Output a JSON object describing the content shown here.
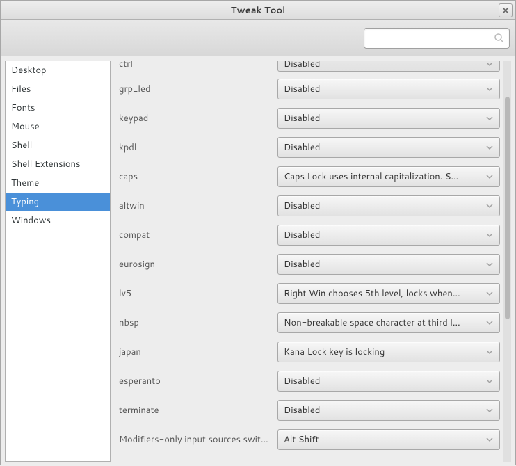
{
  "window": {
    "title": "Tweak Tool"
  },
  "search": {
    "value": "",
    "placeholder": ""
  },
  "sidebar": {
    "items": [
      {
        "label": "Desktop",
        "selected": false
      },
      {
        "label": "Files",
        "selected": false
      },
      {
        "label": "Fonts",
        "selected": false
      },
      {
        "label": "Mouse",
        "selected": false
      },
      {
        "label": "Shell",
        "selected": false
      },
      {
        "label": "Shell Extensions",
        "selected": false
      },
      {
        "label": "Theme",
        "selected": false
      },
      {
        "label": "Typing",
        "selected": true
      },
      {
        "label": "Windows",
        "selected": false
      }
    ]
  },
  "settings": {
    "rows": [
      {
        "label": "ctrl",
        "value": "Disabled"
      },
      {
        "label": "grp_led",
        "value": "Disabled"
      },
      {
        "label": "keypad",
        "value": "Disabled"
      },
      {
        "label": "kpdl",
        "value": "Disabled"
      },
      {
        "label": "caps",
        "value": "Caps Lock uses internal capitalization. S…"
      },
      {
        "label": "altwin",
        "value": "Disabled"
      },
      {
        "label": "compat",
        "value": "Disabled"
      },
      {
        "label": "eurosign",
        "value": "Disabled"
      },
      {
        "label": "lv5",
        "value": "Right Win chooses 5th level, locks when…"
      },
      {
        "label": "nbsp",
        "value": "Non-breakable space character at third l…"
      },
      {
        "label": "japan",
        "value": "Kana Lock key is locking"
      },
      {
        "label": "esperanto",
        "value": "Disabled"
      },
      {
        "label": "terminate",
        "value": "Disabled"
      },
      {
        "label": "Modifiers-only input sources swit…",
        "value": "Alt Shift"
      }
    ]
  }
}
